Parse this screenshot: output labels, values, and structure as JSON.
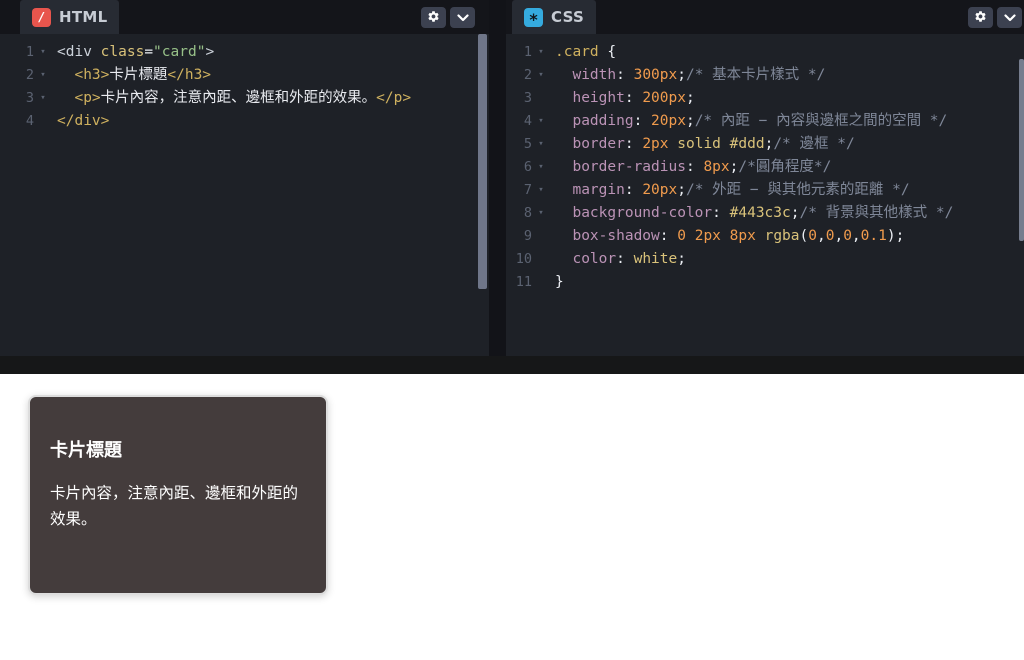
{
  "colors": {
    "html_accent": "#e8554d",
    "css_accent": "#35abdf",
    "card_background": "#443c3c",
    "card_border": "#dddddd",
    "card_text": "white"
  },
  "editors": {
    "html": {
      "label": "HTML",
      "icon_glyph": "/",
      "lines": [
        {
          "n": "1",
          "fold": true,
          "segs": [
            {
              "t": "<div ",
              "c": "d"
            },
            {
              "t": "class",
              "c": "a"
            },
            {
              "t": "=",
              "c": "w"
            },
            {
              "t": "\"card\"",
              "c": "s"
            },
            {
              "t": ">",
              "c": "d"
            }
          ]
        },
        {
          "n": "2",
          "fold": true,
          "segs": [
            {
              "t": "  ",
              "c": "t"
            },
            {
              "t": "<h3>",
              "c": "g"
            },
            {
              "t": "卡片標題",
              "c": "t"
            },
            {
              "t": "</h3>",
              "c": "g"
            }
          ]
        },
        {
          "n": "3",
          "fold": true,
          "segs": [
            {
              "t": "  ",
              "c": "t"
            },
            {
              "t": "<p>",
              "c": "g"
            },
            {
              "t": "卡片內容，注意內距、邊框和外距的效果。",
              "c": "t"
            },
            {
              "t": "</p>",
              "c": "g"
            }
          ]
        },
        {
          "n": "4",
          "fold": false,
          "segs": [
            {
              "t": "</div>",
              "c": "g"
            }
          ]
        }
      ]
    },
    "css": {
      "label": "CSS",
      "icon_glyph": "*",
      "lines": [
        {
          "n": "1",
          "fold": true,
          "segs": [
            {
              "t": ".card",
              "c": "g"
            },
            {
              "t": " {",
              "c": "w"
            }
          ]
        },
        {
          "n": "2",
          "fold": true,
          "segs": [
            {
              "t": "  ",
              "c": "t"
            },
            {
              "t": "width",
              "c": "p"
            },
            {
              "t": ":",
              "c": "w"
            },
            {
              "t": " ",
              "c": "t"
            },
            {
              "t": "300px",
              "c": "o"
            },
            {
              "t": ";",
              "c": "w"
            },
            {
              "t": "/* 基本卡片樣式 */",
              "c": "c"
            }
          ]
        },
        {
          "n": "3",
          "fold": false,
          "segs": [
            {
              "t": "  ",
              "c": "t"
            },
            {
              "t": "height",
              "c": "p"
            },
            {
              "t": ":",
              "c": "w"
            },
            {
              "t": " ",
              "c": "t"
            },
            {
              "t": "200px",
              "c": "o"
            },
            {
              "t": ";",
              "c": "w"
            }
          ]
        },
        {
          "n": "4",
          "fold": true,
          "segs": [
            {
              "t": "  ",
              "c": "t"
            },
            {
              "t": "padding",
              "c": "p"
            },
            {
              "t": ":",
              "c": "w"
            },
            {
              "t": " ",
              "c": "t"
            },
            {
              "t": "20px",
              "c": "o"
            },
            {
              "t": ";",
              "c": "w"
            },
            {
              "t": "/* 內距 − 內容與邊框之間的空間 */",
              "c": "c"
            }
          ]
        },
        {
          "n": "5",
          "fold": true,
          "segs": [
            {
              "t": "  ",
              "c": "t"
            },
            {
              "t": "border",
              "c": "p"
            },
            {
              "t": ":",
              "c": "w"
            },
            {
              "t": " ",
              "c": "t"
            },
            {
              "t": "2px",
              "c": "o"
            },
            {
              "t": " ",
              "c": "t"
            },
            {
              "t": "solid",
              "c": "v"
            },
            {
              "t": " ",
              "c": "t"
            },
            {
              "t": "#ddd",
              "c": "v"
            },
            {
              "t": ";",
              "c": "w"
            },
            {
              "t": "/* 邊框 */",
              "c": "c"
            }
          ]
        },
        {
          "n": "6",
          "fold": true,
          "segs": [
            {
              "t": "  ",
              "c": "t"
            },
            {
              "t": "border-radius",
              "c": "p"
            },
            {
              "t": ":",
              "c": "w"
            },
            {
              "t": " ",
              "c": "t"
            },
            {
              "t": "8px",
              "c": "o"
            },
            {
              "t": ";",
              "c": "w"
            },
            {
              "t": "/*圓角程度*/",
              "c": "c"
            }
          ]
        },
        {
          "n": "7",
          "fold": true,
          "segs": [
            {
              "t": "  ",
              "c": "t"
            },
            {
              "t": "margin",
              "c": "p"
            },
            {
              "t": ":",
              "c": "w"
            },
            {
              "t": " ",
              "c": "t"
            },
            {
              "t": "20px",
              "c": "o"
            },
            {
              "t": ";",
              "c": "w"
            },
            {
              "t": "/* 外距 − 與其他元素的距離 */",
              "c": "c"
            }
          ]
        },
        {
          "n": "8",
          "fold": true,
          "segs": [
            {
              "t": "  ",
              "c": "t"
            },
            {
              "t": "background-color",
              "c": "p"
            },
            {
              "t": ":",
              "c": "w"
            },
            {
              "t": " ",
              "c": "t"
            },
            {
              "t": "#443c3c",
              "c": "v"
            },
            {
              "t": ";",
              "c": "w"
            },
            {
              "t": "/* 背景與其他樣式 */",
              "c": "c"
            }
          ]
        },
        {
          "n": "9",
          "fold": false,
          "segs": [
            {
              "t": "  ",
              "c": "t"
            },
            {
              "t": "box-shadow",
              "c": "p"
            },
            {
              "t": ":",
              "c": "w"
            },
            {
              "t": " ",
              "c": "t"
            },
            {
              "t": "0",
              "c": "o"
            },
            {
              "t": " ",
              "c": "t"
            },
            {
              "t": "2px",
              "c": "o"
            },
            {
              "t": " ",
              "c": "t"
            },
            {
              "t": "8px",
              "c": "o"
            },
            {
              "t": " ",
              "c": "t"
            },
            {
              "t": "rgba",
              "c": "v"
            },
            {
              "t": "(",
              "c": "w"
            },
            {
              "t": "0",
              "c": "o"
            },
            {
              "t": ",",
              "c": "w"
            },
            {
              "t": "0",
              "c": "o"
            },
            {
              "t": ",",
              "c": "w"
            },
            {
              "t": "0",
              "c": "o"
            },
            {
              "t": ",",
              "c": "w"
            },
            {
              "t": "0.1",
              "c": "o"
            },
            {
              "t": ")",
              "c": "w"
            },
            {
              "t": ";",
              "c": "w"
            }
          ]
        },
        {
          "n": "10",
          "fold": false,
          "segs": [
            {
              "t": "  ",
              "c": "t"
            },
            {
              "t": "color",
              "c": "p"
            },
            {
              "t": ":",
              "c": "w"
            },
            {
              "t": " ",
              "c": "t"
            },
            {
              "t": "white",
              "c": "v"
            },
            {
              "t": ";",
              "c": "w"
            }
          ]
        },
        {
          "n": "11",
          "fold": false,
          "segs": [
            {
              "t": "}",
              "c": "w"
            }
          ]
        }
      ]
    }
  },
  "preview": {
    "card_title": "卡片標題",
    "card_body": "卡片內容，注意內距、邊框和外距的效果。",
    "card_style": "width:300px;height:200px;padding:20px;border:2px solid #ddd;border-radius:8px;background-color:#443c3c;box-shadow:0 2px 8px rgba(0,0,0,0.18);color:white;",
    "html_icon_style": "background:#e8554d;",
    "css_icon_style": "background:#35abdf;"
  }
}
